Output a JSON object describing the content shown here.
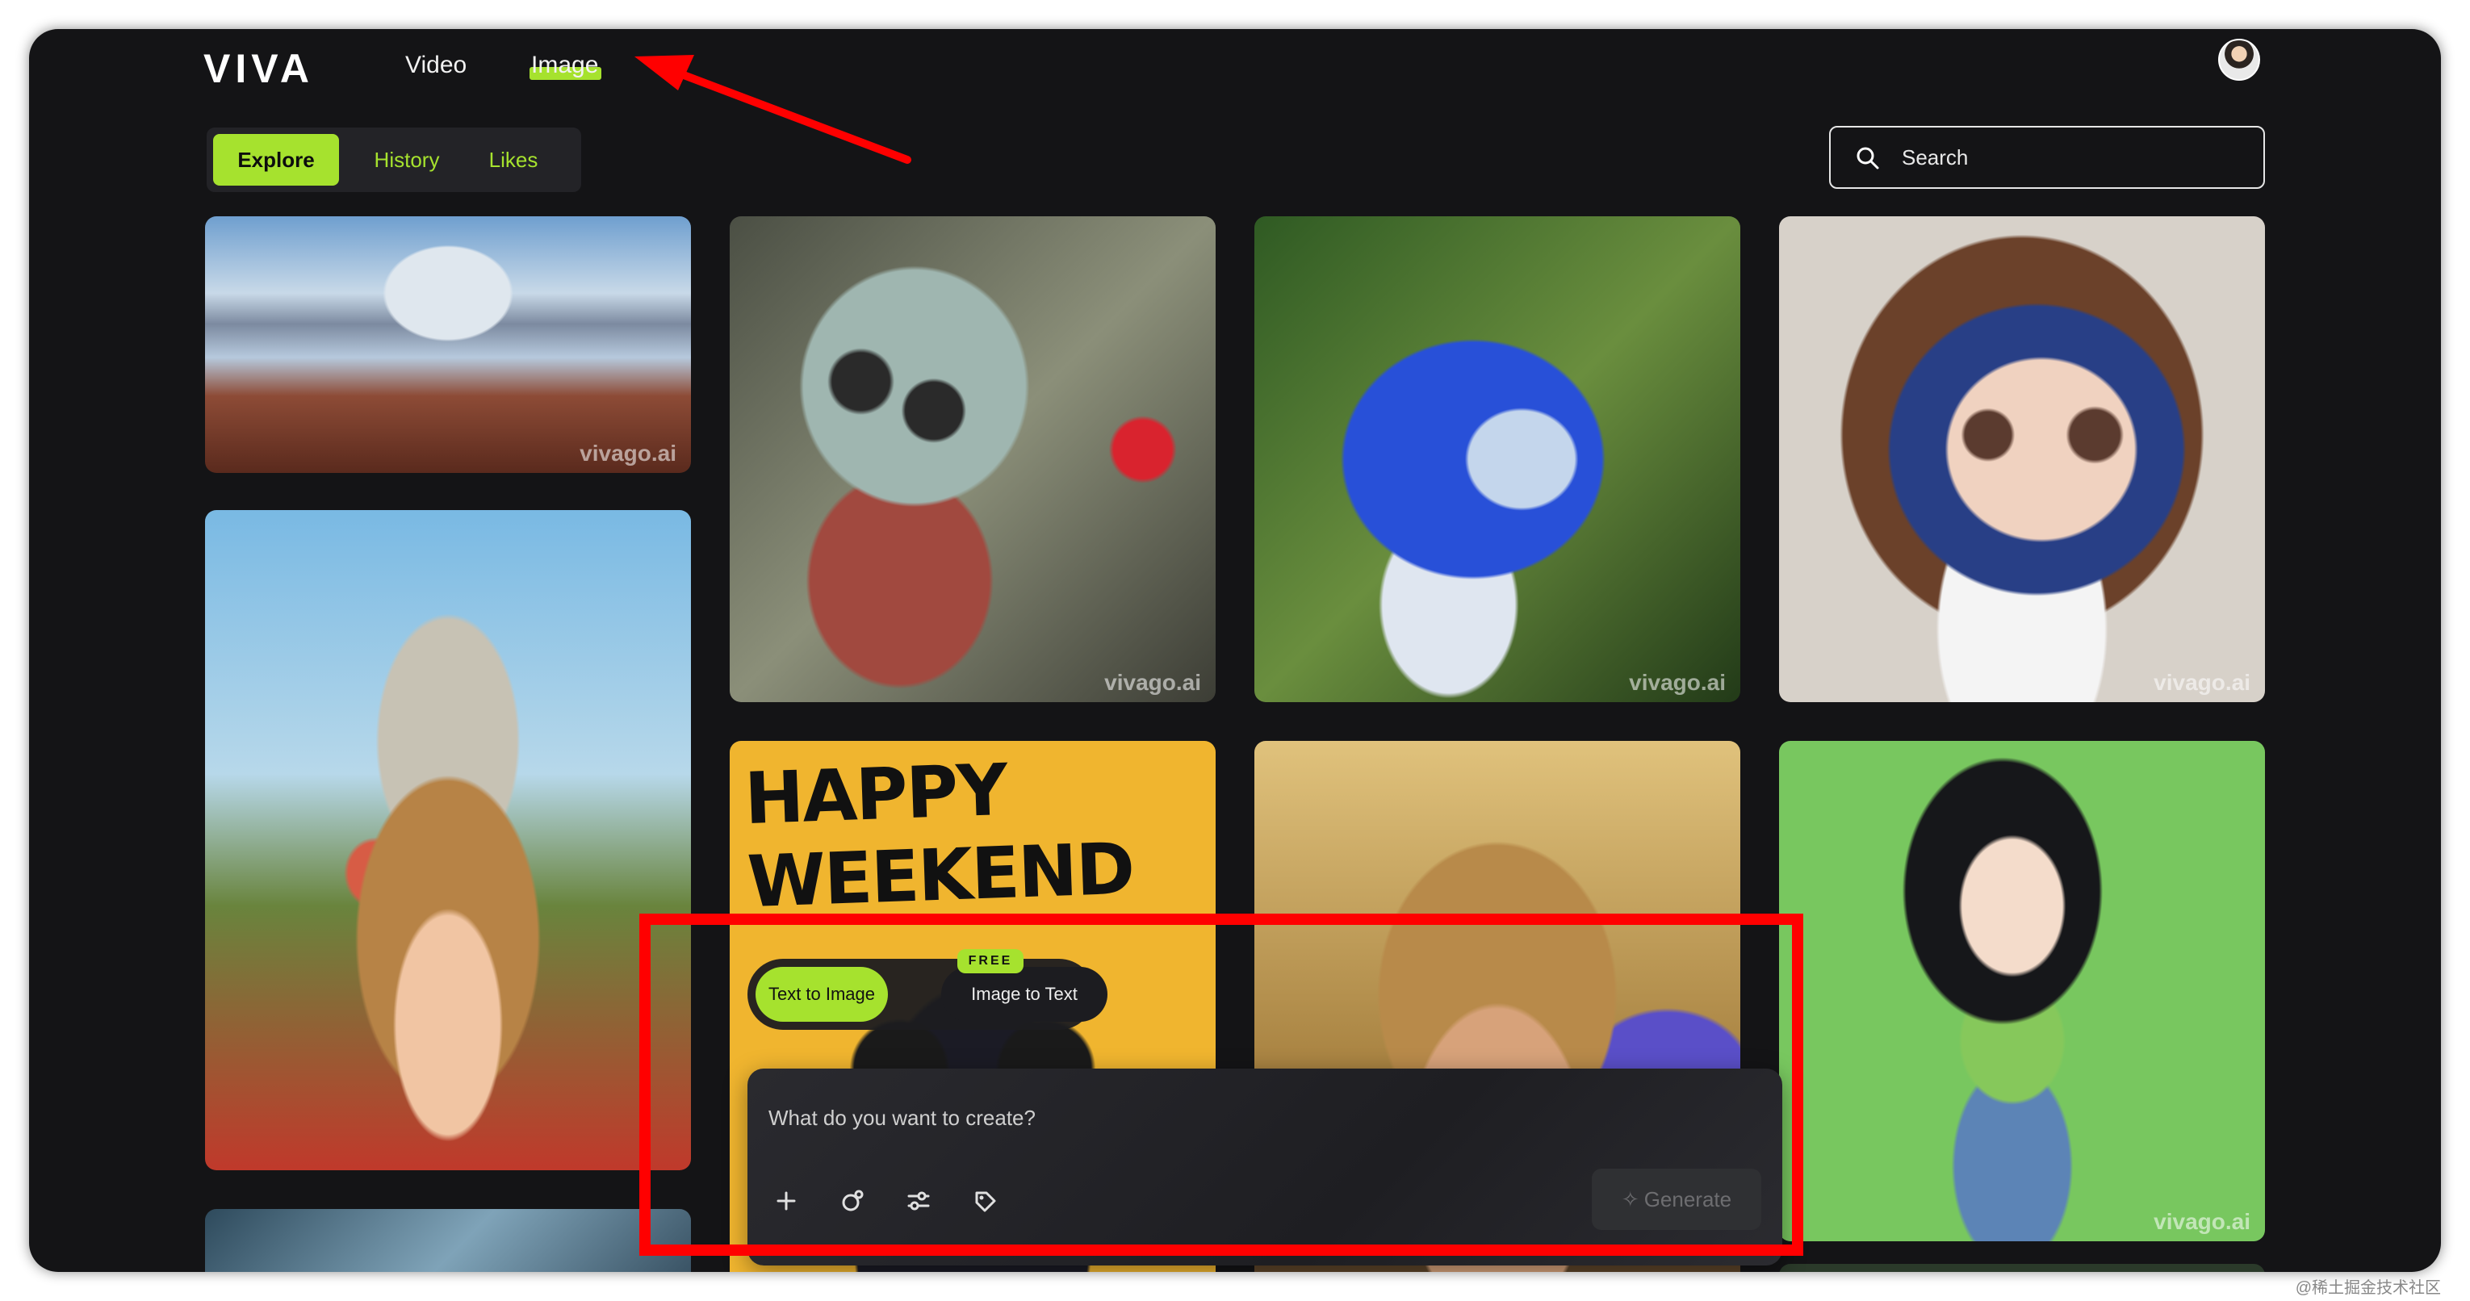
{
  "nav": {
    "logo": "VIVA",
    "links": {
      "video": "Video",
      "image": "Image"
    }
  },
  "tabs": [
    "Explore",
    "History",
    "Likes"
  ],
  "search": {
    "placeholder": "Search"
  },
  "gallery": {
    "watermark": "vivago.ai",
    "card_title": "HAPPY WEEKEND"
  },
  "modes": {
    "text_to_image": "Text to Image",
    "image_to_text": "Image to Text",
    "badge": "FREE"
  },
  "prompt": {
    "placeholder": "What do you want to create?",
    "generate": "Generate"
  },
  "colors": {
    "accent": "#a6e22e",
    "annotation": "#ff0000",
    "background": "#141416"
  },
  "icons": [
    "search-icon",
    "plus-icon",
    "image-reference-icon",
    "settings-sliders-icon",
    "tag-icon",
    "sparkle-icon"
  ],
  "footer": {
    "watermark": "@稀土掘金技术社区"
  }
}
